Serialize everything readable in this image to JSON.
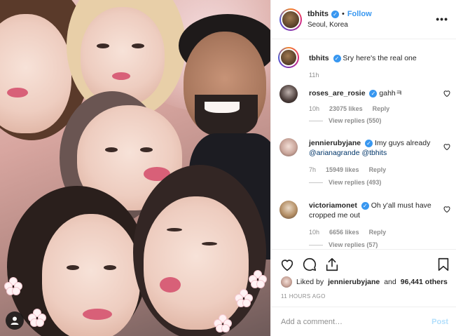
{
  "post": {
    "username": "tbhits",
    "follow_label": "Follow",
    "dot": "•",
    "location": "Seoul, Korea",
    "more_label": "•••"
  },
  "caption": {
    "username": "tbhits",
    "text": "Sry here's the real one",
    "time": "11h"
  },
  "comments": [
    {
      "username": "roses_are_rosie",
      "text": "gahhㅋ",
      "time": "10h",
      "likes": "23075 likes",
      "reply": "Reply",
      "view_replies": "View replies (550)"
    },
    {
      "username": "jennierubyjane",
      "text": "Imy guys already",
      "mention1": "@arianagrande",
      "mention2": "@tbhits",
      "time": "7h",
      "likes": "15949 likes",
      "reply": "Reply",
      "view_replies": "View replies (493)"
    },
    {
      "username": "victoriamonet",
      "text": "Oh y'all must have cropped me out",
      "time": "10h",
      "likes": "6656 likes",
      "reply": "Reply",
      "view_replies": "View replies (57)"
    }
  ],
  "likes": {
    "prefix": "Liked by",
    "user": "jennierubyjane",
    "middle": "and",
    "count": "96,441 others"
  },
  "timestamp": "11 HOURS AGO",
  "add_comment": {
    "placeholder": "Add a comment…",
    "post_label": "Post"
  },
  "colors": {
    "link_blue": "#3897f0",
    "post_disabled": "#b2dffc",
    "meta_gray": "#8e8e8e",
    "text": "#262626"
  },
  "icons": [
    "heart-icon",
    "comment-icon",
    "share-icon",
    "bookmark-icon",
    "verified-icon",
    "more-icon",
    "user-tag-icon"
  ]
}
